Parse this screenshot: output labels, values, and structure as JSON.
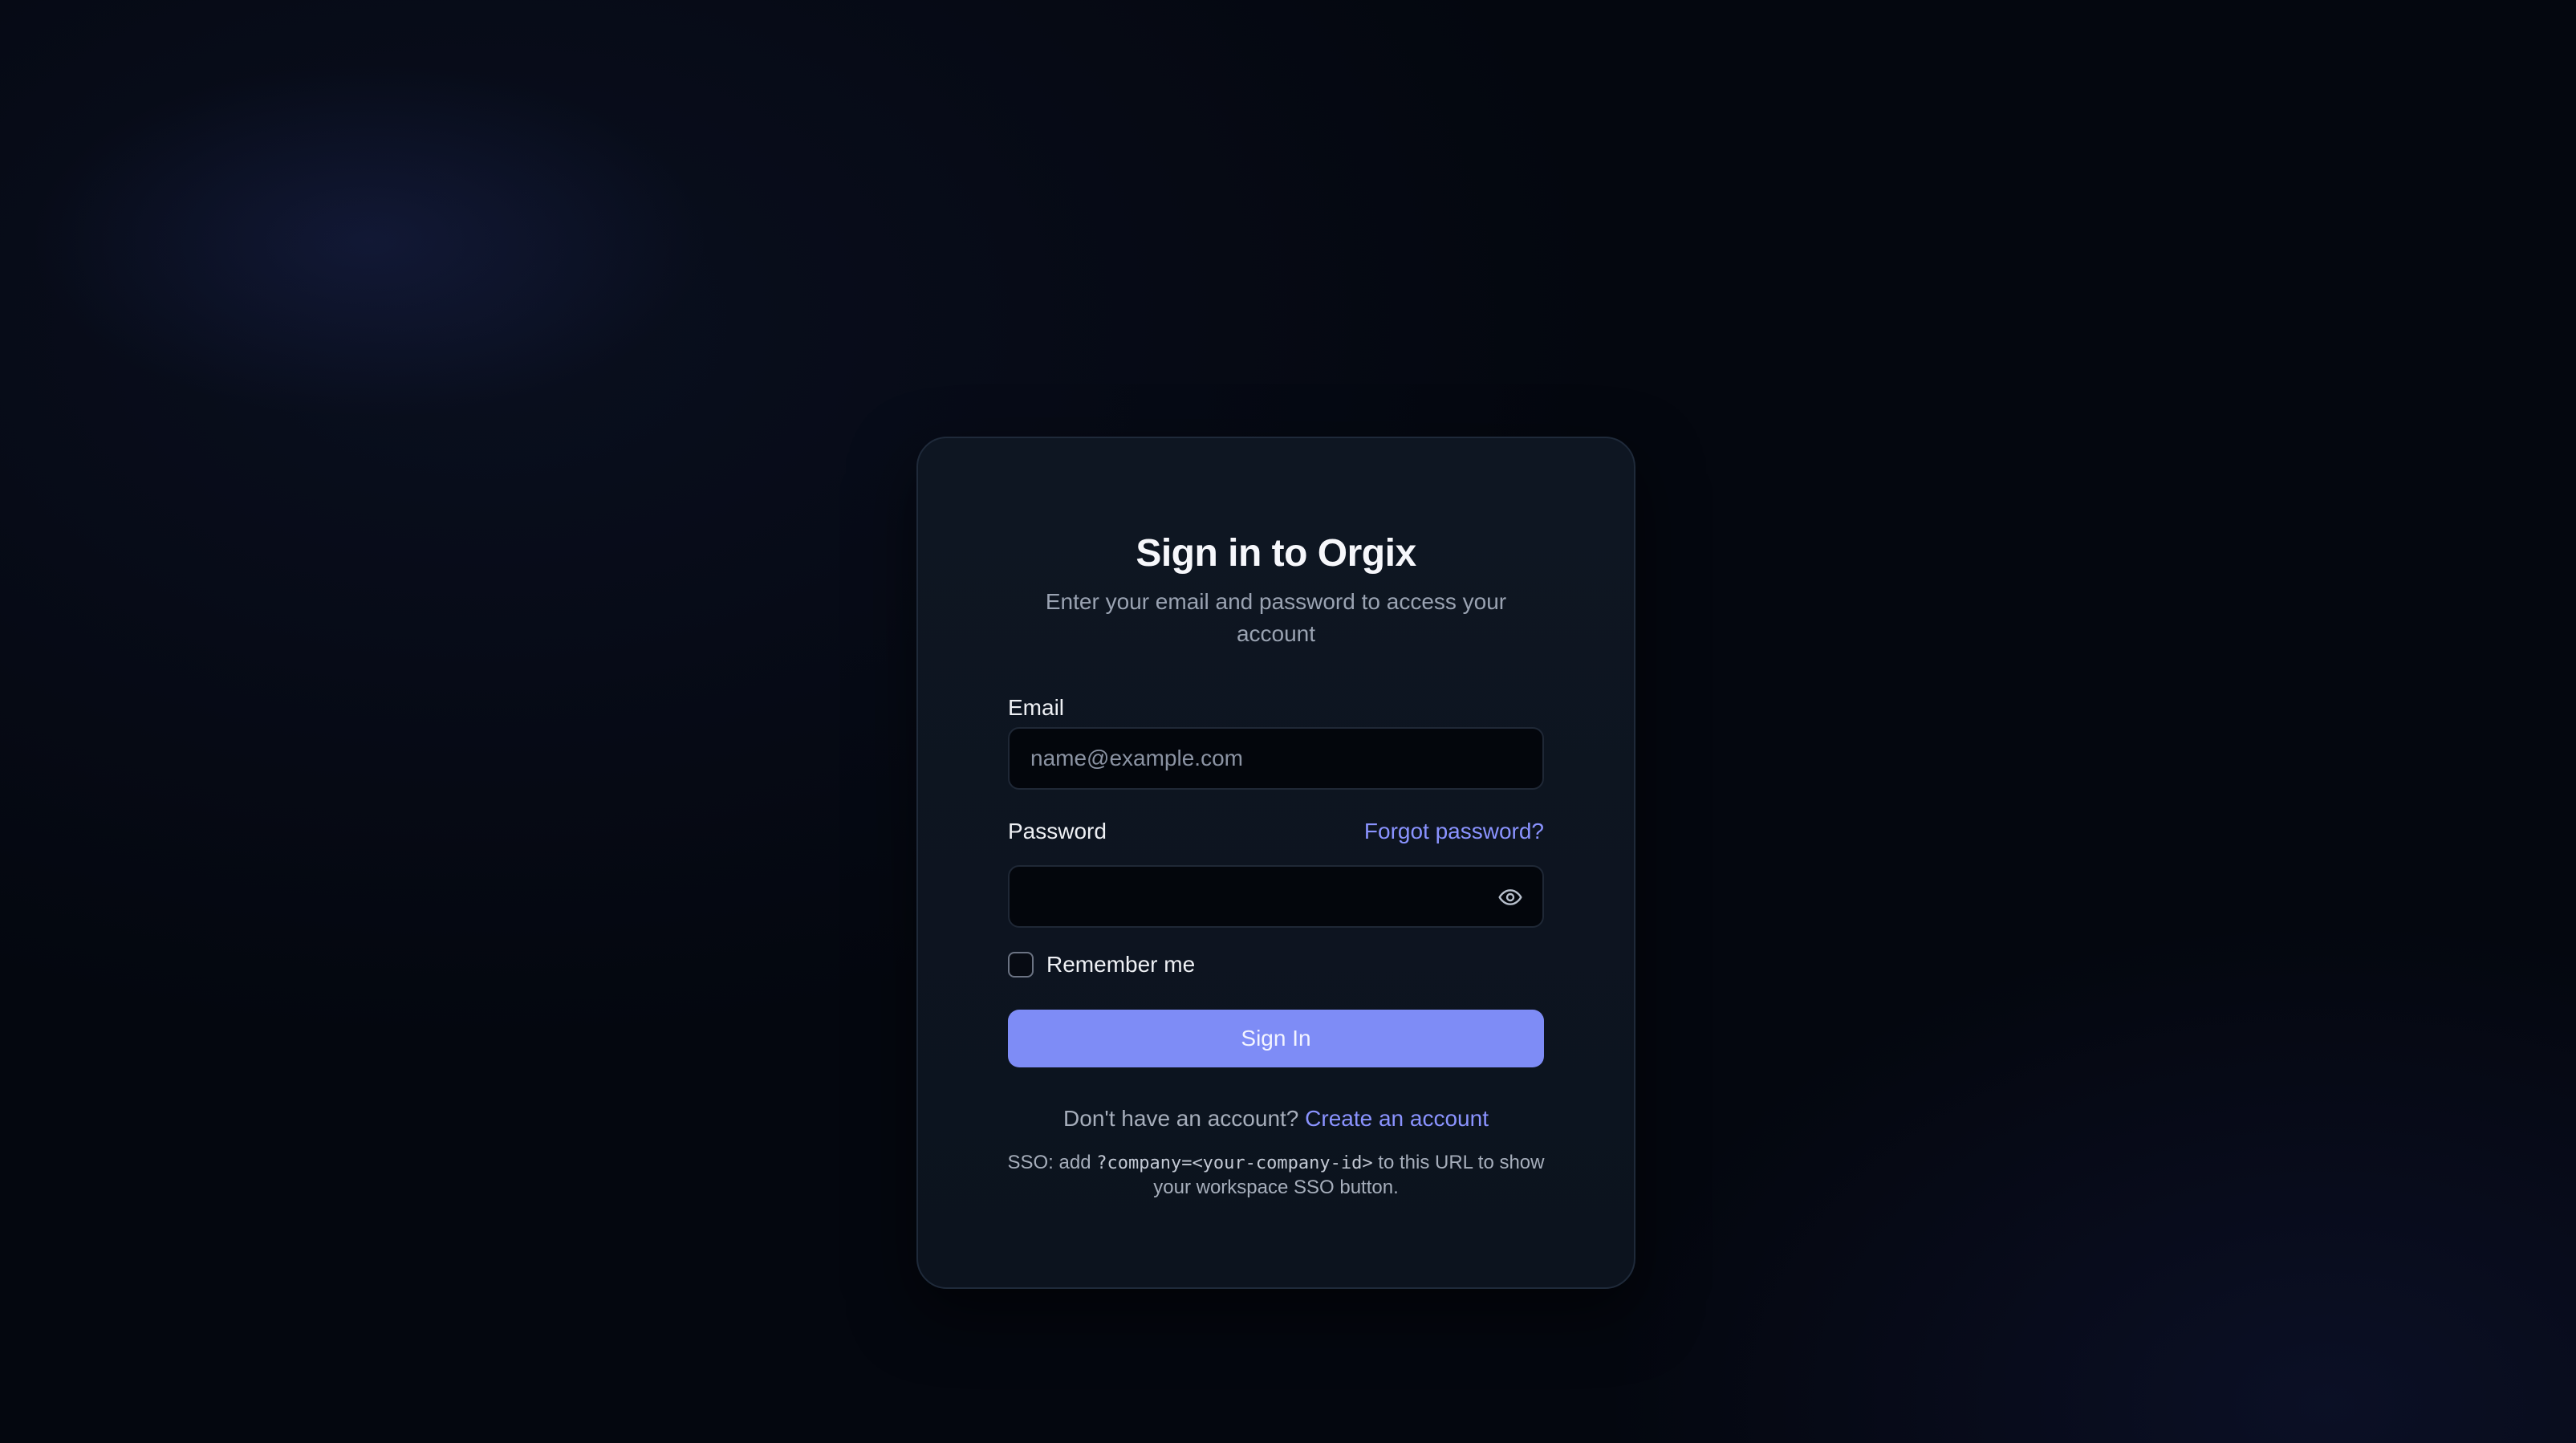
{
  "card": {
    "title": "Sign in to Orgix",
    "subtitle": "Enter your email and password to access your account"
  },
  "email": {
    "label": "Email",
    "value": "",
    "placeholder": "name@example.com"
  },
  "password": {
    "label": "Password",
    "value": "",
    "forgot_label": "Forgot password?",
    "toggle_icon": "eye-icon"
  },
  "remember": {
    "label": "Remember me",
    "checked": false
  },
  "submit": {
    "label": "Sign In"
  },
  "signup": {
    "prompt": "Don't have an account?",
    "link_label": "Create an account"
  },
  "sso": {
    "prefix": "SSO: add",
    "code": "?company=<your-company-id>",
    "suffix": "to this URL to show your workspace SSO button."
  },
  "colors": {
    "accent": "#7e8cf6",
    "link": "#8a93ff",
    "background": "#04070f",
    "card": "#0e1622"
  }
}
